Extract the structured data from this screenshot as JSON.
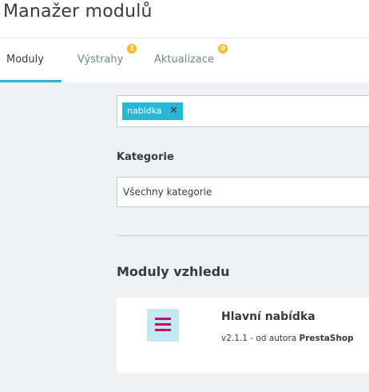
{
  "page": {
    "title": "Manažer modulů"
  },
  "tabs": [
    {
      "label": "Moduly",
      "active": true
    },
    {
      "label": "Výstrahy",
      "badge": "2"
    },
    {
      "label": "Aktualizace",
      "badge": "0"
    }
  ],
  "search": {
    "tag": "nabídka",
    "remove_icon": "close-icon"
  },
  "category": {
    "label": "Kategorie",
    "selected": "Všechny kategorie"
  },
  "section": {
    "title": "Moduly vzhledu"
  },
  "module": {
    "name": "Hlavní nabídka",
    "version_prefix": "v2.1.1 - od autora ",
    "author": "PrestaShop",
    "icon": "menu-icon"
  },
  "colors": {
    "accent": "#25b9d7",
    "badge": "#fbbb22",
    "icon_bg": "#c3e8f1",
    "icon_fg": "#d0076a",
    "background": "#eff1f2"
  }
}
